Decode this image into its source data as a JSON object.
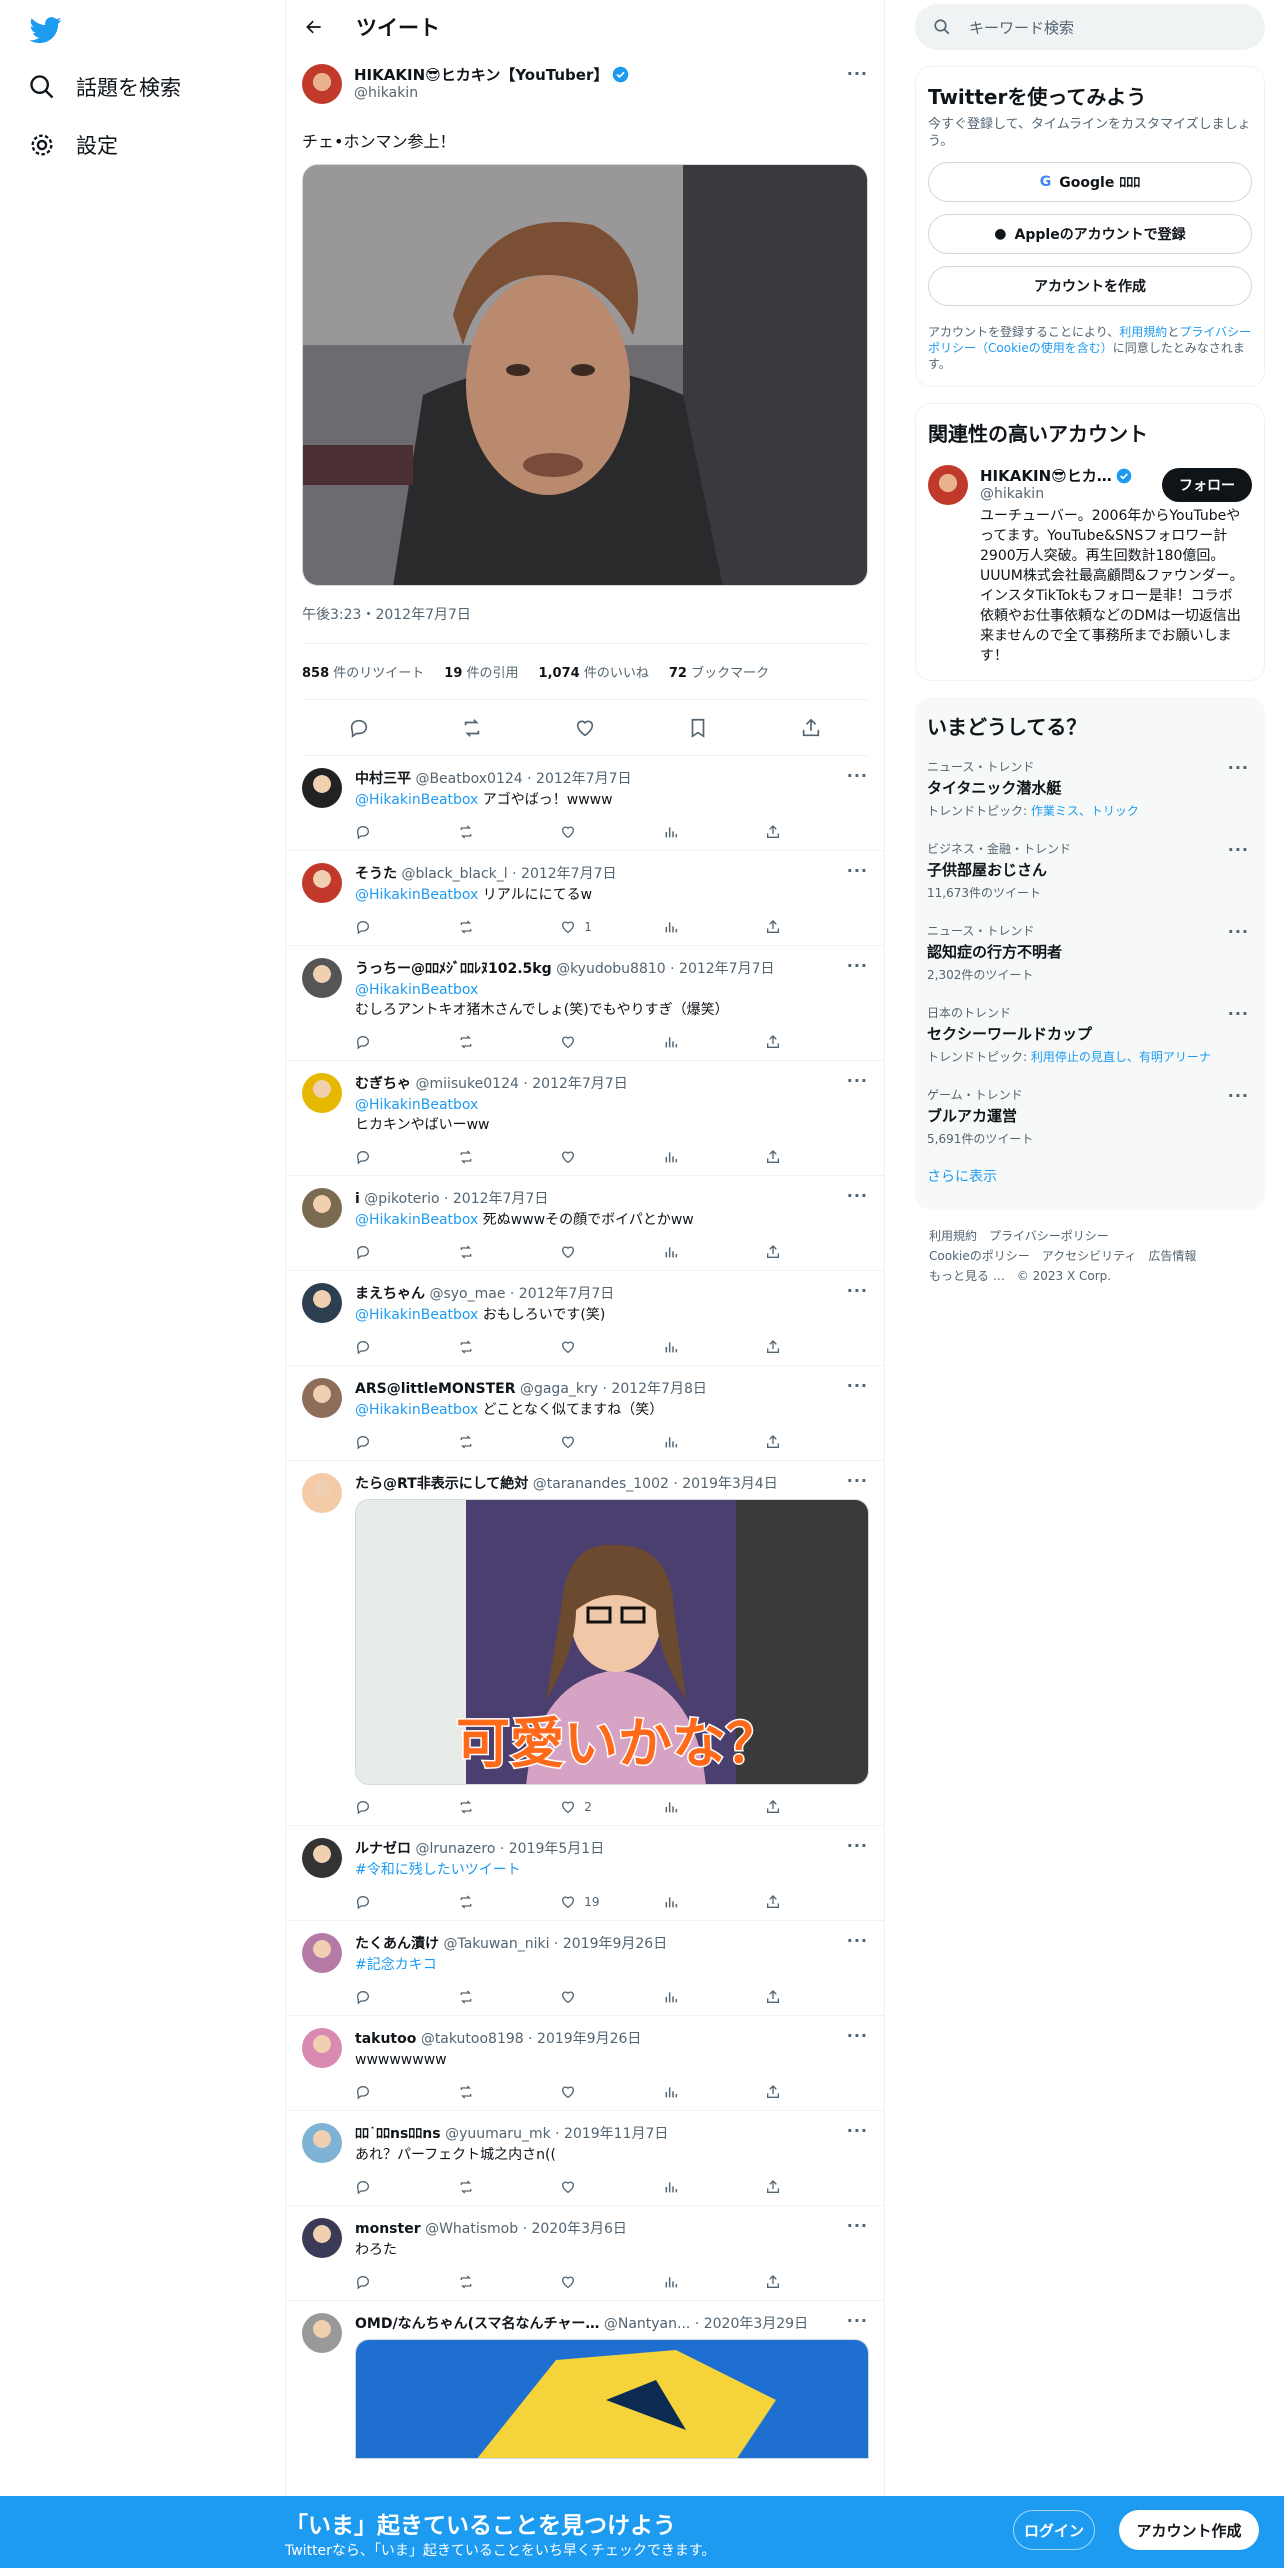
{
  "nav": {
    "explore": "話題を検索",
    "settings": "設定"
  },
  "header": {
    "title": "ツイート"
  },
  "post": {
    "name": "HIKAKIN😎ヒカキン【YouTuber】",
    "handle": "@hikakin",
    "text": "チェ•ホンマン参上！",
    "time": "午後3:23・2012年7月7日",
    "stats": [
      {
        "n": "858",
        "l": "件のリツイート"
      },
      {
        "n": "19",
        "l": "件の引用"
      },
      {
        "n": "1,074",
        "l": "件のいいね"
      },
      {
        "n": "72",
        "l": "ブックマーク"
      }
    ]
  },
  "replies": [
    {
      "name": "中村三平",
      "handle": "@Beatbox0124",
      "date": "2012年7月7日",
      "mention": "@HikakinBeatbox",
      "text": "アゴやばっ！wwww",
      "likes": "",
      "col": "#222"
    },
    {
      "name": "そうた",
      "handle": "@black_black_l",
      "date": "2012年7月7日",
      "mention": "@HikakinBeatbox",
      "text": "リアルににてるw",
      "likes": "1",
      "col": "#c0392b"
    },
    {
      "name": "うっちー@ﾛﾛﾒｼﾞﾛﾛﾚﾇ102.5kg",
      "handle": "@kyudobu8810",
      "date": "2012年7月7日",
      "mention": "@HikakinBeatbox",
      "text": "むしろアントキオ猪木さんでしょ(笑)でもやりすぎ（爆笑）",
      "likes": "",
      "col": "#555",
      "newline": true
    },
    {
      "name": "むぎちゃ",
      "handle": "@miisuke0124",
      "date": "2012年7月7日",
      "mention": "@HikakinBeatbox",
      "text": "ヒカキンやばいーww",
      "likes": "",
      "col": "#e6b800",
      "newline": true
    },
    {
      "name": "i",
      "handle": "@pikoterio",
      "date": "2012年7月7日",
      "mention": "@HikakinBeatbox",
      "text": "死ぬwwwその顔でボイパとかww",
      "likes": "",
      "col": "#7a6a4f"
    },
    {
      "name": "まえちゃん",
      "handle": "@syo_mae",
      "date": "2012年7月7日",
      "mention": "@HikakinBeatbox",
      "text": "おもしろいです(笑)",
      "likes": "",
      "col": "#2c3e50"
    },
    {
      "name": "ARS@littleMONSTER",
      "handle": "@gaga_kry",
      "date": "2012年7月8日",
      "mention": "@HikakinBeatbox",
      "text": "どことなく似てますね（笑）",
      "likes": "",
      "col": "#8e6e5b"
    },
    {
      "name": "たら@RT非表示にして絶対",
      "handle": "@taranandes_1002",
      "date": "2019年3月4日",
      "mention": "",
      "text": "",
      "likes": "2",
      "col": "#f5cba7",
      "image": true,
      "imgcap": "可愛いかな？"
    },
    {
      "name": "ルナゼロ",
      "handle": "@lrunazero",
      "date": "2019年5月1日",
      "mention": "#令和に残したいツイート",
      "text": "",
      "likes": "19",
      "col": "#333"
    },
    {
      "name": "たくあん漬け",
      "handle": "@Takuwan_niki",
      "date": "2019年9月26日",
      "mention": "#記念カキコ",
      "text": "",
      "likes": "",
      "col": "#b57ba6"
    },
    {
      "name": "takutoo",
      "handle": "@takutoo8198",
      "date": "2019年9月26日",
      "mention": "",
      "text": "wwwwwwww",
      "likes": "",
      "col": "#d98ab0"
    },
    {
      "name": "ﾛﾛ˙ﾛﾛnsﾛﾛns",
      "handle": "@yuumaru_mk",
      "date": "2019年11月7日",
      "mention": "",
      "text": "あれ？パーフェクト城之内さn((",
      "likes": "",
      "col": "#7fb3d5"
    },
    {
      "name": "monster",
      "handle": "@Whatismob",
      "date": "2020年3月6日",
      "mention": "",
      "text": "わろた",
      "likes": "",
      "col": "#3b3b58"
    },
    {
      "name": "OMD/なんちゃん(スマ名なんチャー…",
      "handle": "@Nantyan...",
      "date": "2020年3月29日",
      "mention": "",
      "text": "",
      "likes": "",
      "col": "#999",
      "image2": true
    }
  ],
  "right": {
    "search_placeholder": "キーワード検索",
    "signup": {
      "title": "Twitterを使ってみよう",
      "sub": "今すぐ登録して、タイムラインをカスタマイズしましょう。",
      "google": "Google ﾛﾛﾛ",
      "apple": "Appleのアカウントで登録",
      "create": "アカウントを作成",
      "legal1": "アカウントを登録することにより、",
      "legal_link1": "利用規約",
      "legal2": "と",
      "legal_link2": "プライバシーポリシー（Cookieの使用を含む）",
      "legal3": "に同意したとみなされます。"
    },
    "related": {
      "title": "関連性の高いアカウント",
      "name": "HIKAKIN😎ヒカ…",
      "handle": "@hikakin",
      "follow": "フォロー",
      "bio": "ユーチューバー。2006年からYouTubeやってます。YouTube&SNSフォロワー計2900万人突破。再生回数計180億回。UUUM株式会社最高顧問&ファウンダー。インスタTikTokもフォロー是非！コラボ依頼やお仕事依頼などのDMは一切返信出来ませんので全て事務所までお願いします！"
    },
    "trends": {
      "title": "いまどうしてる？",
      "items": [
        {
          "cat": "ニュース・トレンド",
          "name": "タイタニック潜水艇",
          "sub": "トレンドトピック: ",
          "links": "作業ミス、トリック"
        },
        {
          "cat": "ビジネス・金融・トレンド",
          "name": "子供部屋おじさん",
          "sub": "11,673件のツイート",
          "links": ""
        },
        {
          "cat": "ニュース・トレンド",
          "name": "認知症の行方不明者",
          "sub": "2,302件のツイート",
          "links": ""
        },
        {
          "cat": "日本のトレンド",
          "name": "セクシーワールドカップ",
          "sub": "トレンドトピック: ",
          "links": "利用停止の見直し、有明アリーナ"
        },
        {
          "cat": "ゲーム・トレンド",
          "name": "ブルアカ運営",
          "sub": "5,691件のツイート",
          "links": ""
        }
      ],
      "more": "さらに表示"
    },
    "footer": [
      "利用規約",
      "プライバシーポリシー",
      "Cookieのポリシー",
      "アクセシビリティ",
      "広告情報",
      "もっと見る …",
      "© 2023 X Corp."
    ]
  },
  "bottom": {
    "title": "「いま」起きていることを見つけよう",
    "sub": "Twitterなら、「いま」起きていることをいち早くチェックできます。",
    "login": "ログイン",
    "signup": "アカウント作成"
  },
  "colors": {
    "accent": "#1d9bf0",
    "verified": "#1d9bf0"
  }
}
